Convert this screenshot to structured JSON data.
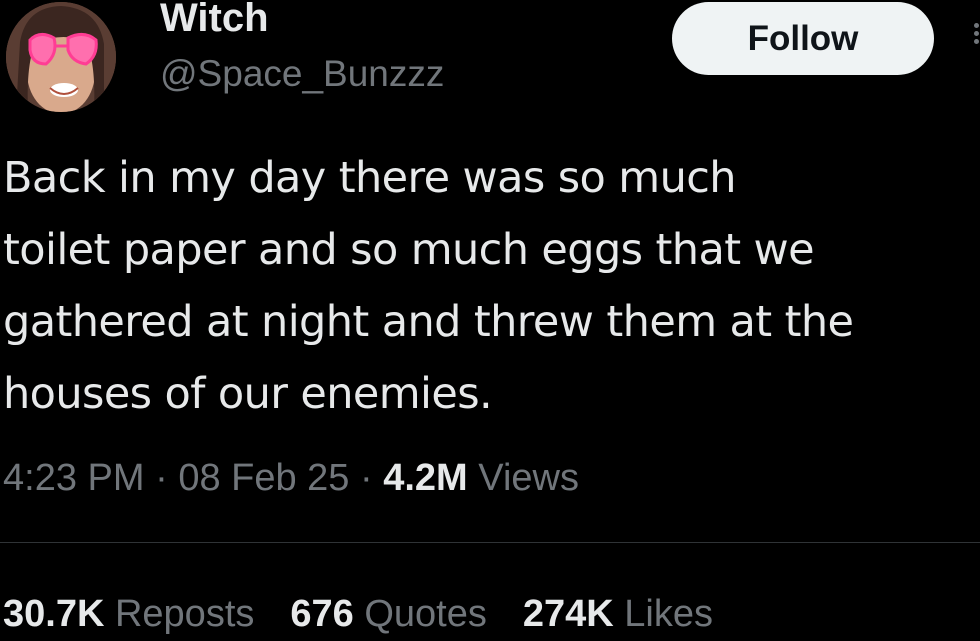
{
  "author": {
    "display_name": "Witch",
    "handle": "@Space_Bunzzz"
  },
  "follow_label": "Follow",
  "tweet": {
    "text": "Back in my day there was so much\ntoilet paper and so much eggs that we\ngathered at night and threw them at the\nhouses of our enemies."
  },
  "meta": {
    "time": "4:23 PM",
    "separator": "·",
    "date": "08 Feb 25",
    "views_count": "4.2M",
    "views_label": "Views"
  },
  "stats": {
    "reposts_count": "30.7K",
    "reposts_label": "Reposts",
    "quotes_count": "676",
    "quotes_label": "Quotes",
    "likes_count": "274K",
    "likes_label": "Likes"
  },
  "colors": {
    "background": "#000000",
    "primary_text": "#e7e9ea",
    "secondary_text": "#71767b",
    "follow_button_bg": "#eff3f4",
    "divider": "#2f3336"
  },
  "icons": {
    "more": "more-dots-icon"
  }
}
